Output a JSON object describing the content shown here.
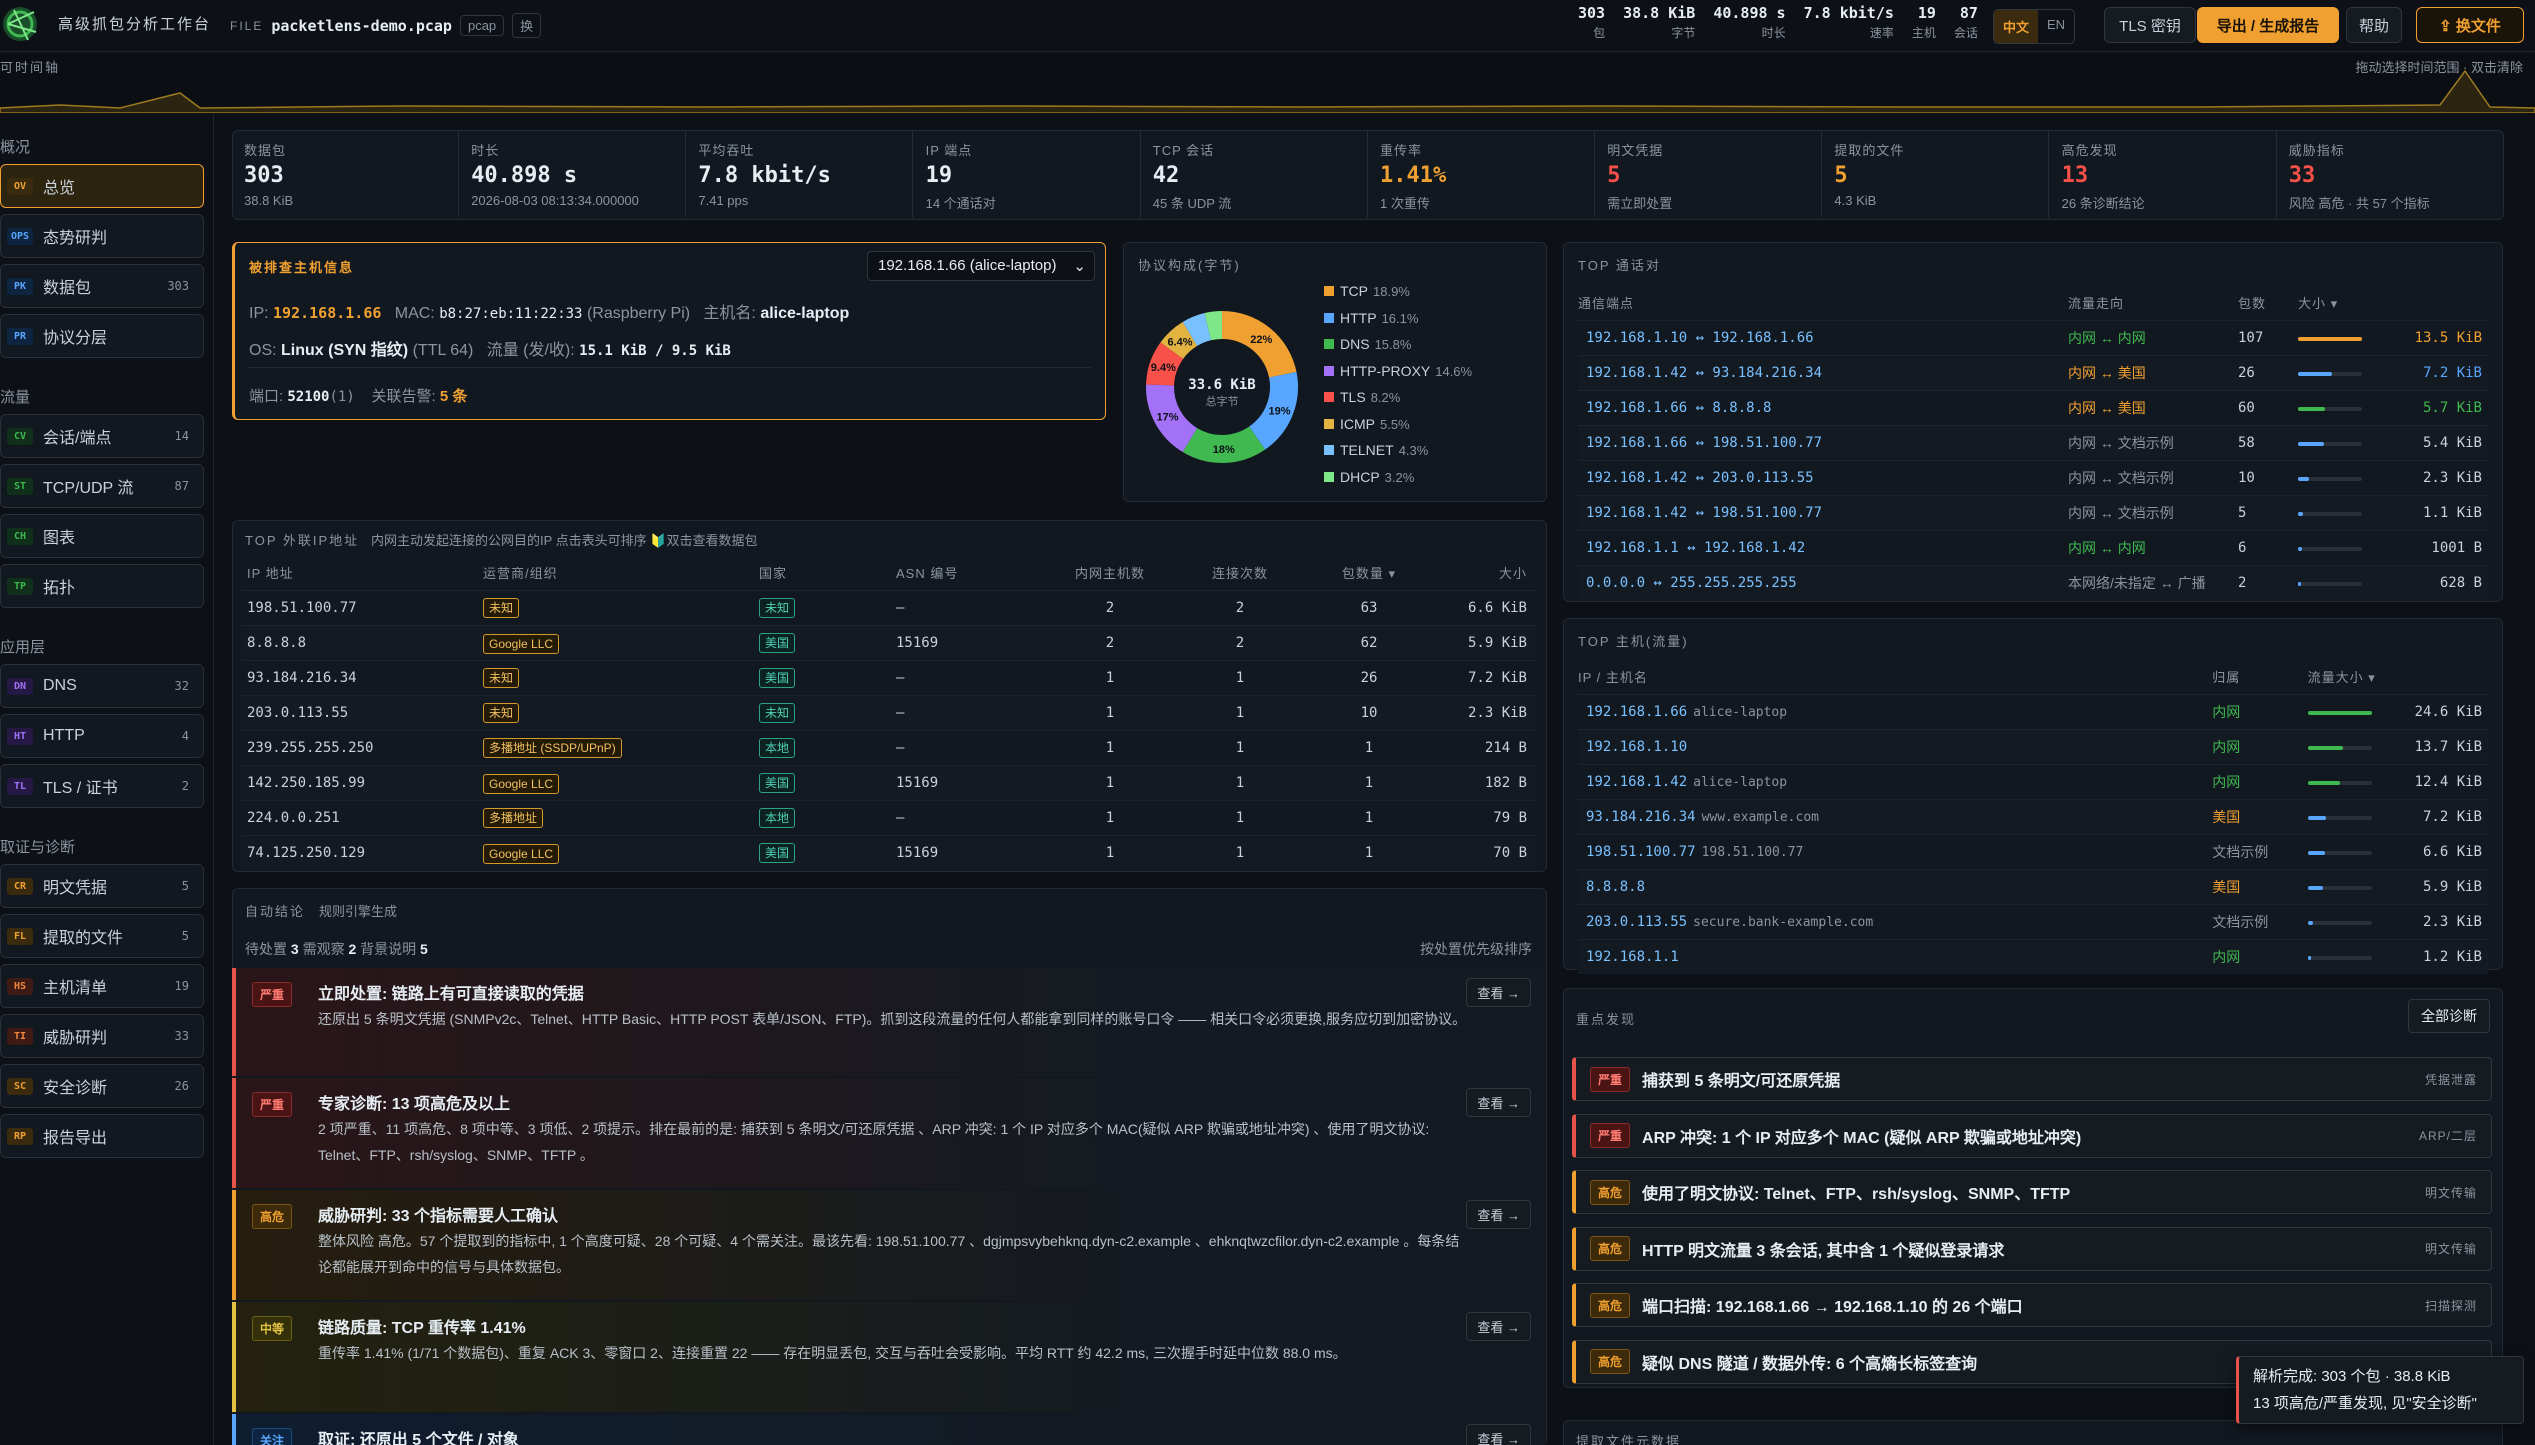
{
  "app": {
    "title": "高级抓包分析工作台",
    "file_label": "FILE",
    "file_name": "packetlens-demo.pcap",
    "file_type": "pcap",
    "swap": "换"
  },
  "top_stats": [
    {
      "value": "303",
      "label": "包"
    },
    {
      "value": "38.8 KiB",
      "label": "字节"
    },
    {
      "value": "40.898 s",
      "label": "时长"
    },
    {
      "value": "7.8 kbit/s",
      "label": "速率"
    },
    {
      "value": "19",
      "label": "主机"
    },
    {
      "value": "87",
      "label": "会话"
    }
  ],
  "lang": {
    "zh": "中文",
    "en": "EN"
  },
  "toolbar": {
    "tls": "TLS 密钥",
    "export": "导出 / 生成报告",
    "help": "帮助",
    "swap_file": "⇪ 换文件"
  },
  "timeline": {
    "label": "可时间轴",
    "hint": "拖动选择时间范围 · 双击清除"
  },
  "sidebar": {
    "sec_overview": "概况",
    "sec_flow": "流量",
    "sec_app": "应用层",
    "sec_forensics": "取证与诊断",
    "items": [
      {
        "tag": "OV",
        "label": "总览",
        "count": ""
      },
      {
        "tag": "OPS",
        "label": "态势研判",
        "count": ""
      },
      {
        "tag": "PK",
        "label": "数据包",
        "count": "303"
      },
      {
        "tag": "PR",
        "label": "协议分层",
        "count": ""
      },
      {
        "tag": "CV",
        "label": "会话/端点",
        "count": "14"
      },
      {
        "tag": "ST",
        "label": "TCP/UDP 流",
        "count": "87"
      },
      {
        "tag": "CH",
        "label": "图表",
        "count": ""
      },
      {
        "tag": "TP",
        "label": "拓扑",
        "count": ""
      },
      {
        "tag": "DN",
        "label": "DNS",
        "count": "32"
      },
      {
        "tag": "HT",
        "label": "HTTP",
        "count": "4"
      },
      {
        "tag": "TL",
        "label": "TLS / 证书",
        "count": "2"
      },
      {
        "tag": "CR",
        "label": "明文凭据",
        "count": "5"
      },
      {
        "tag": "FL",
        "label": "提取的文件",
        "count": "5"
      },
      {
        "tag": "HS",
        "label": "主机清单",
        "count": "19"
      },
      {
        "tag": "TI",
        "label": "威胁研判",
        "count": "33"
      },
      {
        "tag": "SC",
        "label": "安全诊断",
        "count": "26"
      },
      {
        "tag": "RP",
        "label": "报告导出",
        "count": ""
      }
    ]
  },
  "kpis": [
    {
      "label": "数据包",
      "value": "303",
      "sub": "38.8 KiB"
    },
    {
      "label": "时长",
      "value": "40.898 s",
      "sub": "2026-08-03 08:13:34.000000"
    },
    {
      "label": "平均吞吐",
      "value": "7.8 kbit/s",
      "sub": "7.41 pps"
    },
    {
      "label": "IP 端点",
      "value": "19",
      "sub": "14 个通话对"
    },
    {
      "label": "TCP 会话",
      "value": "42",
      "sub": "45 条 UDP 流"
    },
    {
      "label": "重传率",
      "value": "1.41%",
      "sub": "1 次重传"
    },
    {
      "label": "明文凭据",
      "value": "5",
      "sub": "需立即处置"
    },
    {
      "label": "提取的文件",
      "value": "5",
      "sub": "4.3 KiB"
    },
    {
      "label": "高危发现",
      "value": "13",
      "sub": "26 条诊断结论"
    },
    {
      "label": "威胁指标",
      "value": "33",
      "sub": "风险 高危 · 共 57 个指标"
    }
  ],
  "host": {
    "title": "被排查主机信息",
    "select": "192.168.1.66 (alice-laptop)",
    "ip_label": "IP:",
    "ip": "192.168.1.66",
    "mac_label": "MAC:",
    "mac": "b8:27:eb:11:22:33",
    "vendor": "(Raspberry Pi)",
    "host_label": "主机名:",
    "hostname": "alice-laptop",
    "os_label": "OS:",
    "os": "Linux (SYN 指纹)",
    "ttl": "(TTL 64)",
    "flow_label": "流量 (发/收):",
    "flow": "15.1 KiB / 9.5 KiB",
    "port_label": "端口:",
    "port": "52100",
    "port_count": "(1)",
    "alert_label": "关联告警:",
    "alert": "5 条"
  },
  "proto": {
    "title": "协议构成(字节)",
    "center_value": "33.6 KiB",
    "center_label": "总字节",
    "slices": [
      {
        "name": "TCP",
        "pct": 18.9,
        "label": "18.9%",
        "color": "#f0a030",
        "tag": ""
      },
      {
        "name": "HTTP",
        "pct": 16.1,
        "label": "16.1%",
        "color": "#58a6ff",
        "tag": ""
      },
      {
        "name": "DNS",
        "pct": 15.8,
        "label": "15.8%",
        "color": "#3fb950",
        "tag": ""
      },
      {
        "name": "HTTP-PROXY",
        "pct": 14.6,
        "label": "14.6%",
        "color": "#a371f7",
        "tag": ""
      },
      {
        "name": "TLS",
        "pct": 8.2,
        "label": "8.2%",
        "color": "#f85149",
        "tag": ""
      },
      {
        "name": "ICMP",
        "pct": 5.5,
        "label": "5.5%",
        "color": "#e3b341",
        "tag": ""
      },
      {
        "name": "TELNET",
        "pct": 4.3,
        "label": "4.3%",
        "color": "#79c0ff",
        "tag": ""
      },
      {
        "name": "DHCP",
        "pct": 3.2,
        "label": "3.2%",
        "color": "#7ee787",
        "tag": ""
      }
    ],
    "ring_labels": [
      "22%",
      "19%",
      "18%",
      "17%",
      "9.4%",
      "6.4%"
    ]
  },
  "top_talk": {
    "title": "TOP 通话对",
    "headers": [
      "通信端点",
      "流量走向",
      "包数",
      "大小 ▾"
    ],
    "rows": [
      {
        "ep": "192.168.1.10 ↔ 192.168.1.66",
        "dir": "内网 ↔ 内网",
        "dc": "in",
        "pk": "107",
        "size": "13.5 KiB",
        "frac": 1.0,
        "bc": "#f0a030"
      },
      {
        "ep": "192.168.1.42 ↔ 93.184.216.34",
        "dir": "内网 ↔ 美国",
        "dc": "us",
        "pk": "26",
        "size": "7.2 KiB",
        "frac": 0.53,
        "bc": "#58a6ff"
      },
      {
        "ep": "192.168.1.66 ↔ 8.8.8.8",
        "dir": "内网 ↔ 美国",
        "dc": "us",
        "pk": "60",
        "size": "5.7 KiB",
        "frac": 0.42,
        "bc": "#3fb950"
      },
      {
        "ep": "192.168.1.66 ↔ 198.51.100.77",
        "dir": "内网 ↔ 文档示例",
        "dc": "doc",
        "pk": "58",
        "size": "5.4 KiB",
        "frac": 0.4,
        "bc": "#58a6ff"
      },
      {
        "ep": "192.168.1.42 ↔ 203.0.113.55",
        "dir": "内网 ↔ 文档示例",
        "dc": "doc",
        "pk": "10",
        "size": "2.3 KiB",
        "frac": 0.17,
        "bc": "#58a6ff"
      },
      {
        "ep": "192.168.1.42 ↔ 198.51.100.77",
        "dir": "内网 ↔ 文档示例",
        "dc": "doc",
        "pk": "5",
        "size": "1.1 KiB",
        "frac": 0.08,
        "bc": "#58a6ff"
      },
      {
        "ep": "192.168.1.1 ↔ 192.168.1.42",
        "dir": "内网 ↔ 内网",
        "dc": "in",
        "pk": "6",
        "size": "1001 B",
        "frac": 0.07,
        "bc": "#58a6ff"
      },
      {
        "ep": "0.0.0.0 ↔ 255.255.255.255",
        "dir": "本网络/未指定 ↔ 广播",
        "dc": "doc",
        "pk": "2",
        "size": "628 B",
        "frac": 0.05,
        "bc": "#58a6ff"
      }
    ]
  },
  "top_hosts": {
    "title": "TOP 主机(流量)",
    "headers": [
      "IP / 主机名",
      "归属",
      "流量大小 ▾"
    ],
    "rows": [
      {
        "ip": "192.168.1.66",
        "name": "alice-laptop",
        "own": "内网",
        "oc": "in",
        "size": "24.6 KiB",
        "frac": 1.0,
        "bc": "#3fb950"
      },
      {
        "ip": "192.168.1.10",
        "name": "",
        "own": "内网",
        "oc": "in",
        "size": "13.7 KiB",
        "frac": 0.56,
        "bc": "#3fb950"
      },
      {
        "ip": "192.168.1.42",
        "name": "alice-laptop",
        "own": "内网",
        "oc": "in",
        "size": "12.4 KiB",
        "frac": 0.5,
        "bc": "#3fb950"
      },
      {
        "ip": "93.184.216.34",
        "name": "www.example.com",
        "own": "美国",
        "oc": "us",
        "size": "7.2 KiB",
        "frac": 0.29,
        "bc": "#58a6ff"
      },
      {
        "ip": "198.51.100.77",
        "name": "198.51.100.77",
        "own": "文档示例",
        "oc": "doc",
        "size": "6.6 KiB",
        "frac": 0.27,
        "bc": "#58a6ff"
      },
      {
        "ip": "8.8.8.8",
        "name": "",
        "own": "美国",
        "oc": "us",
        "size": "5.9 KiB",
        "frac": 0.24,
        "bc": "#58a6ff"
      },
      {
        "ip": "203.0.113.55",
        "name": "secure.bank-example.com",
        "own": "文档示例",
        "oc": "doc",
        "size": "2.3 KiB",
        "frac": 0.09,
        "bc": "#58a6ff"
      },
      {
        "ip": "192.168.1.1",
        "name": "",
        "own": "内网",
        "oc": "in",
        "size": "1.2 KiB",
        "frac": 0.05,
        "bc": "#58a6ff"
      }
    ]
  },
  "ext_ip": {
    "title": "TOP 外联IP地址",
    "subtitle": "内网主动发起连接的公网目的IP 点击表头可排序 🔰双击查看数据包",
    "headers": [
      "IP 地址",
      "运营商/组织",
      "国家",
      "ASN 编号",
      "内网主机数",
      "连接次数",
      "包数量 ▾",
      "大小"
    ],
    "rows": [
      {
        "ip": "198.51.100.77",
        "org": "未知",
        "cty": "未知",
        "asn": "—",
        "hosts": "2",
        "conn": "2",
        "pk": "63",
        "size": "6.6 KiB"
      },
      {
        "ip": "8.8.8.8",
        "org": "Google LLC",
        "cty": "美国",
        "asn": "15169",
        "hosts": "2",
        "conn": "2",
        "pk": "62",
        "size": "5.9 KiB"
      },
      {
        "ip": "93.184.216.34",
        "org": "未知",
        "cty": "美国",
        "asn": "—",
        "hosts": "1",
        "conn": "1",
        "pk": "26",
        "size": "7.2 KiB"
      },
      {
        "ip": "203.0.113.55",
        "org": "未知",
        "cty": "未知",
        "asn": "—",
        "hosts": "1",
        "conn": "1",
        "pk": "10",
        "size": "2.3 KiB"
      },
      {
        "ip": "239.255.255.250",
        "org": "多播地址 (SSDP/UPnP)",
        "cty": "本地",
        "asn": "—",
        "hosts": "1",
        "conn": "1",
        "pk": "1",
        "size": "214 B"
      },
      {
        "ip": "142.250.185.99",
        "org": "Google LLC",
        "cty": "美国",
        "asn": "15169",
        "hosts": "1",
        "conn": "1",
        "pk": "1",
        "size": "182 B"
      },
      {
        "ip": "224.0.0.251",
        "org": "多播地址",
        "cty": "本地",
        "asn": "—",
        "hosts": "1",
        "conn": "1",
        "pk": "1",
        "size": "79 B"
      },
      {
        "ip": "74.125.250.129",
        "org": "Google LLC",
        "cty": "美国",
        "asn": "15169",
        "hosts": "1",
        "conn": "1",
        "pk": "1",
        "size": "70 B"
      }
    ]
  },
  "auto": {
    "title": "自动结论",
    "subtitle": "规则引擎生成",
    "summary_pre": "待处置",
    "summary_n1": "3",
    "summary_mid": "需观察",
    "summary_n2": "2",
    "summary_mid2": "背景说明",
    "summary_n3": "5",
    "sort_hint": "按处置优先级排序",
    "view": "查看 →",
    "items": [
      {
        "sev": "严重",
        "cls": "red",
        "title": "立即处置: 链路上有可直接读取的凭据",
        "desc": "还原出 5 条明文凭据 (SNMPv2c、Telnet、HTTP Basic、HTTP POST 表单/JSON、FTP)。抓到这段流量的任何人都能拿到同样的账号口令 —— 相关口令必须更换,服务应切到加密协议。"
      },
      {
        "sev": "严重",
        "cls": "red",
        "title": "专家诊断: 13 项高危及以上",
        "desc": "2 项严重、11 项高危、8 项中等、3 项低、2 项提示。排在最前的是: 捕获到 5 条明文/可还原凭据 、ARP 冲突: 1 个 IP 对应多个 MAC(疑似 ARP 欺骗或地址冲突) 、使用了明文协议: Telnet、FTP、rsh/syslog、SNMP、TFTP 。"
      },
      {
        "sev": "高危",
        "cls": "or",
        "title": "威胁研判: 33 个指标需要人工确认",
        "desc": "整体风险 高危。57 个提取到的指标中, 1 个高度可疑、28 个可疑、4 个需关注。最该先看: 198.51.100.77 、dgjmpsvybehknq.dyn-c2.example 、ehknqtwzcfilor.dyn-c2.example 。每条结论都能展开到命中的信号与具体数据包。"
      },
      {
        "sev": "中等",
        "cls": "yl",
        "title": "链路质量: TCP 重传率 1.41%",
        "desc": "重传率 1.41% (1/71 个数据包)、重复 ACK 3、零窗口 2、连接重置 22 —— 存在明显丢包, 交互与吞吐会受影响。平均 RTT 约 42.2 ms, 三次握手时延中位数 88.0 ms。"
      },
      {
        "sev": "关注",
        "cls": "bl",
        "title": "取证: 还原出 5 个文件 / 对象",
        "desc": ""
      }
    ]
  },
  "findings": {
    "title": "重点发现",
    "all_btn": "全部诊断",
    "items": [
      {
        "sev": "严重",
        "cls": "red",
        "title": "捕获到 5 条明文/可还原凭据",
        "cat": "凭据泄露",
        "bc": "#e5534b"
      },
      {
        "sev": "严重",
        "cls": "red",
        "title": "ARP 冲突: 1 个 IP 对应多个 MAC (疑似 ARP 欺骗或地址冲突)",
        "cat": "ARP/二层",
        "bc": "#e5534b"
      },
      {
        "sev": "高危",
        "cls": "or",
        "title": "使用了明文协议: Telnet、FTP、rsh/syslog、SNMP、TFTP",
        "cat": "明文传输",
        "bc": "#f0a030"
      },
      {
        "sev": "高危",
        "cls": "or",
        "title": "HTTP 明文流量 3 条会话, 其中含 1 个疑似登录请求",
        "cat": "明文传输",
        "bc": "#f0a030"
      },
      {
        "sev": "高危",
        "cls": "or",
        "title": "端口扫描: 192.168.1.66 → 192.168.1.10 的 26 个端口",
        "cat": "扫描探测",
        "bc": "#f0a030"
      },
      {
        "sev": "高危",
        "cls": "or",
        "title": "疑似 DNS 隧道 / 数据外传: 6 个高熵长标签查询",
        "cat": "",
        "bc": "#f0a030"
      }
    ],
    "next_title": "提取文件元数据"
  },
  "toast": {
    "line1": "解析完成: 303 个包 · 38.8 KiB",
    "line2": "13 项高危/严重发现, 见\"安全诊断\""
  }
}
